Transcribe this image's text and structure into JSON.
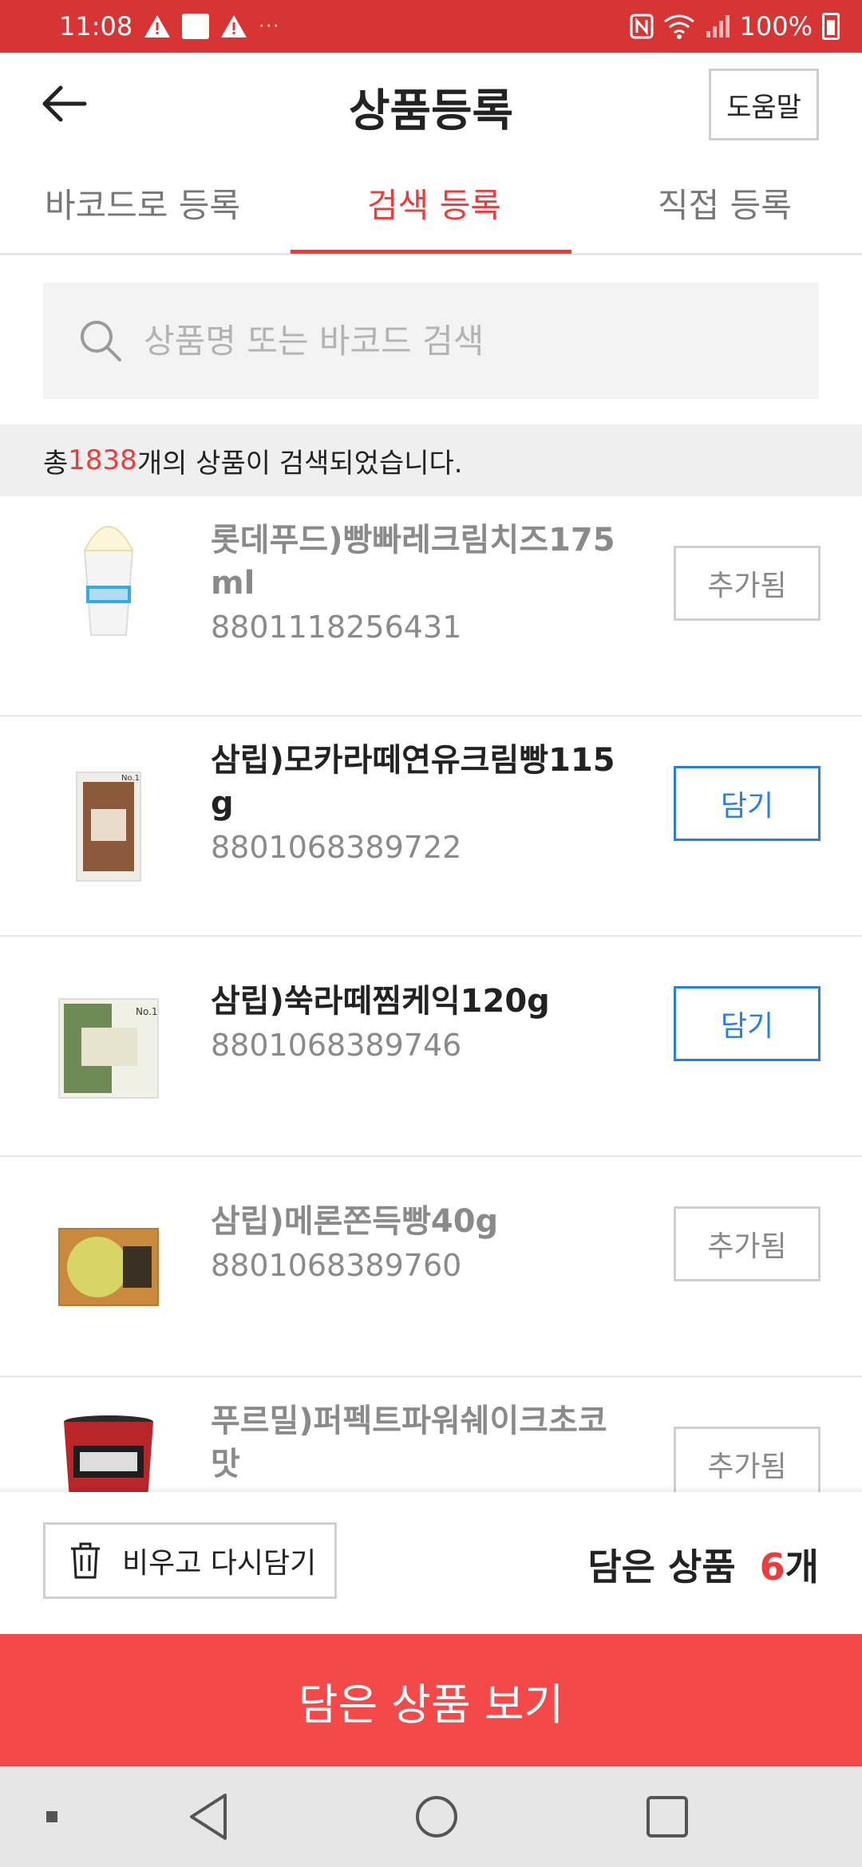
{
  "status_bar": {
    "time": "11:08",
    "dots": "···",
    "battery": "100%"
  },
  "header": {
    "title": "상품등록",
    "help_label": "도움말"
  },
  "tabs": [
    {
      "label": "바코드로 등록",
      "active": false
    },
    {
      "label": "검색 등록",
      "active": true
    },
    {
      "label": "직접 등록",
      "active": false
    }
  ],
  "search": {
    "placeholder": "상품명 또는 바코드 검색"
  },
  "result": {
    "prefix": "총 ",
    "count": "1838",
    "suffix": "개의 상품이 검색되었습니다."
  },
  "products": [
    {
      "name_line1": "롯데푸드)빵빠레크림치즈175",
      "name_line2": "ml",
      "barcode": "8801118256431",
      "action": "추가됨",
      "status": "added"
    },
    {
      "name_line1": "삼립)모카라떼연유크림빵115",
      "name_line2": "g",
      "barcode": "8801068389722",
      "action": "담기",
      "status": "add"
    },
    {
      "name_line1": "삼립)쑥라떼찜케익120g",
      "barcode": "8801068389746",
      "action": "담기",
      "status": "add"
    },
    {
      "name_line1": "삼립)메론쫀득빵40g",
      "barcode": "8801068389760",
      "action": "추가됨",
      "status": "added"
    },
    {
      "name_line1": "푸르밀)퍼펙트파워쉐이크초코",
      "name_line2": "맛",
      "action": "추가됨",
      "status": "added"
    }
  ],
  "bottom": {
    "clear_label": "비우고 다시담기",
    "cart_label": "담은 상품",
    "cart_count": "6",
    "cart_unit": "개",
    "view_cart_label": "담은 상품 보기"
  },
  "colors": {
    "accent": "#ee3b3b",
    "status_bar": "#d73434",
    "add_blue": "#2a7de1",
    "cta": "#f54848"
  }
}
